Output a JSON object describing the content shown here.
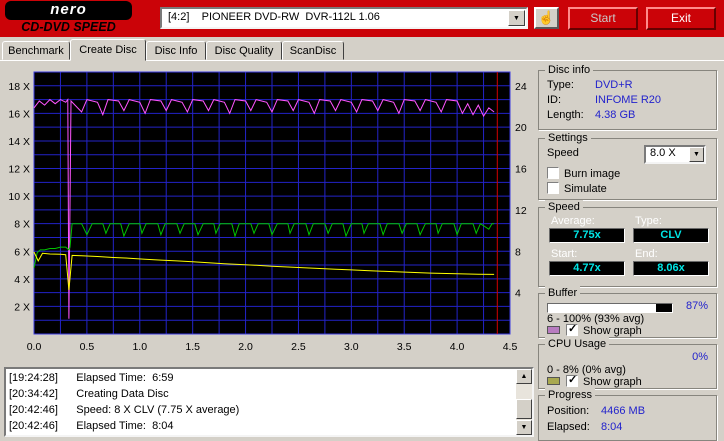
{
  "icons": {
    "chevron_down": "▼",
    "arrow_up": "▲",
    "arrow_down": "▼",
    "hand": "☝",
    "check": "✓"
  },
  "header": {
    "logo_primary": "nero",
    "logo_secondary": "CD-DVD SPEED",
    "drive_select": "[4:2]    PIONEER DVD-RW  DVR-112L 1.06",
    "start_label": "Start",
    "exit_label": "Exit"
  },
  "tabs": [
    {
      "label": "Benchmark"
    },
    {
      "label": "Create Disc"
    },
    {
      "label": "Disc Info"
    },
    {
      "label": "Disc Quality"
    },
    {
      "label": "ScanDisc"
    }
  ],
  "chart_data": {
    "type": "line",
    "title": "Create Disc write test",
    "x_axis": {
      "min": 0,
      "max": 4.5,
      "grid_step": 0.25,
      "unit": "GB",
      "ticks": [
        {
          "v": 0,
          "label": "0.0"
        },
        {
          "v": 0.5,
          "label": "0.5"
        },
        {
          "v": 1,
          "label": "1.0"
        },
        {
          "v": 1.5,
          "label": "1.5"
        },
        {
          "v": 2,
          "label": "2.0"
        },
        {
          "v": 2.5,
          "label": "2.5"
        },
        {
          "v": 3,
          "label": "3.0"
        },
        {
          "v": 3.5,
          "label": "3.5"
        },
        {
          "v": 4,
          "label": "4.0"
        },
        {
          "v": 4.5,
          "label": "4.5"
        }
      ]
    },
    "y_axis_left": {
      "min": 0,
      "max": 19,
      "grid_step": 1,
      "unit": "x speed",
      "ticks": [
        {
          "v": 2,
          "label": "2 X"
        },
        {
          "v": 4,
          "label": "4 X"
        },
        {
          "v": 6,
          "label": "6 X"
        },
        {
          "v": 8,
          "label": "8 X"
        },
        {
          "v": 10,
          "label": "10 X"
        },
        {
          "v": 12,
          "label": "12 X"
        },
        {
          "v": 14,
          "label": "14 X"
        },
        {
          "v": 16,
          "label": "16 X"
        },
        {
          "v": 18,
          "label": "18 X"
        }
      ]
    },
    "y_axis_right": {
      "scale_to_left": 0.75,
      "ticks": [
        {
          "v": 4,
          "label": "4"
        },
        {
          "v": 8,
          "label": "8"
        },
        {
          "v": 12,
          "label": "12"
        },
        {
          "v": 16,
          "label": "16"
        },
        {
          "v": 20,
          "label": "20"
        },
        {
          "v": 24,
          "label": "24"
        }
      ]
    },
    "colors": {
      "background": "#000000",
      "grid": "#2323c8",
      "border": "#3a3ae0"
    },
    "series": [
      {
        "name": "buffer-level",
        "color": "#ff55ff",
        "points": [
          [
            0,
            16.4
          ],
          [
            0.05,
            16.9
          ],
          [
            0.1,
            16.6
          ],
          [
            0.15,
            17
          ],
          [
            0.2,
            16.7
          ],
          [
            0.25,
            17
          ],
          [
            0.3,
            16.8
          ],
          [
            0.32,
            17
          ],
          [
            0.33,
            1.1
          ],
          [
            0.35,
            16.9
          ],
          [
            0.45,
            16.1
          ],
          [
            0.5,
            17
          ],
          [
            0.6,
            16.8
          ],
          [
            0.65,
            15.9
          ],
          [
            0.7,
            17
          ],
          [
            0.8,
            16.9
          ],
          [
            0.85,
            16.2
          ],
          [
            0.9,
            17
          ],
          [
            1,
            16.8
          ],
          [
            1.05,
            16
          ],
          [
            1.1,
            17
          ],
          [
            1.2,
            16.9
          ],
          [
            1.25,
            16.2
          ],
          [
            1.3,
            17
          ],
          [
            1.4,
            16.8
          ],
          [
            1.45,
            16.1
          ],
          [
            1.5,
            17
          ],
          [
            1.6,
            16.9
          ],
          [
            1.65,
            16.2
          ],
          [
            1.7,
            17
          ],
          [
            1.8,
            16.8
          ],
          [
            1.85,
            16
          ],
          [
            1.9,
            17
          ],
          [
            2,
            16.9
          ],
          [
            2.05,
            16.2
          ],
          [
            2.1,
            17
          ],
          [
            2.2,
            16.8
          ],
          [
            2.25,
            16.1
          ],
          [
            2.3,
            17
          ],
          [
            2.4,
            16.9
          ],
          [
            2.45,
            16.2
          ],
          [
            2.5,
            17
          ],
          [
            2.6,
            16.8
          ],
          [
            2.65,
            16
          ],
          [
            2.7,
            17
          ],
          [
            2.8,
            16.9
          ],
          [
            2.85,
            16.2
          ],
          [
            2.9,
            17
          ],
          [
            3,
            16.8
          ],
          [
            3.05,
            16.1
          ],
          [
            3.1,
            17
          ],
          [
            3.2,
            16.9
          ],
          [
            3.25,
            16.2
          ],
          [
            3.3,
            17
          ],
          [
            3.4,
            16.8
          ],
          [
            3.45,
            16
          ],
          [
            3.5,
            17
          ],
          [
            3.6,
            16.9
          ],
          [
            3.65,
            16.2
          ],
          [
            3.7,
            17
          ],
          [
            3.8,
            16.8
          ],
          [
            3.85,
            16.1
          ],
          [
            3.9,
            17
          ],
          [
            4,
            16.9
          ],
          [
            4.05,
            16
          ],
          [
            4.1,
            16.7
          ],
          [
            4.15,
            15.9
          ],
          [
            4.2,
            16.6
          ],
          [
            4.25,
            15.8
          ],
          [
            4.3,
            16.4
          ],
          [
            4.35,
            16.1
          ]
        ]
      },
      {
        "name": "write-speed",
        "color": "#00c400",
        "points": [
          [
            0,
            4.8
          ],
          [
            0.03,
            5.9
          ],
          [
            0.06,
            6.1
          ],
          [
            0.1,
            6.1
          ],
          [
            0.15,
            6.2
          ],
          [
            0.2,
            6.2
          ],
          [
            0.25,
            6.3
          ],
          [
            0.3,
            6.3
          ],
          [
            0.33,
            6.1
          ],
          [
            0.34,
            6.3
          ],
          [
            0.36,
            8
          ],
          [
            0.45,
            8
          ],
          [
            0.5,
            7.2
          ],
          [
            0.55,
            8
          ],
          [
            0.65,
            8
          ],
          [
            0.68,
            7.3
          ],
          [
            0.72,
            8
          ],
          [
            0.82,
            8
          ],
          [
            0.85,
            7.1
          ],
          [
            0.9,
            8
          ],
          [
            1,
            8
          ],
          [
            1.02,
            7.3
          ],
          [
            1.06,
            8
          ],
          [
            1.17,
            8
          ],
          [
            1.2,
            7.2
          ],
          [
            1.24,
            8
          ],
          [
            1.35,
            8
          ],
          [
            1.38,
            7.3
          ],
          [
            1.42,
            8
          ],
          [
            1.52,
            8
          ],
          [
            1.55,
            7.2
          ],
          [
            1.6,
            8
          ],
          [
            1.7,
            8
          ],
          [
            1.72,
            7.3
          ],
          [
            1.76,
            8
          ],
          [
            1.87,
            8
          ],
          [
            1.9,
            7.1
          ],
          [
            1.94,
            8
          ],
          [
            2.05,
            8
          ],
          [
            2.08,
            7.3
          ],
          [
            2.12,
            8
          ],
          [
            2.22,
            8
          ],
          [
            2.25,
            7.2
          ],
          [
            2.3,
            8
          ],
          [
            2.4,
            8
          ],
          [
            2.42,
            7.3
          ],
          [
            2.46,
            8
          ],
          [
            2.57,
            8
          ],
          [
            2.6,
            7.2
          ],
          [
            2.64,
            8
          ],
          [
            2.75,
            8
          ],
          [
            2.78,
            7.3
          ],
          [
            2.82,
            8
          ],
          [
            2.92,
            8
          ],
          [
            2.95,
            7.1
          ],
          [
            3,
            8
          ],
          [
            3.1,
            8
          ],
          [
            3.12,
            7.3
          ],
          [
            3.16,
            8
          ],
          [
            3.27,
            8
          ],
          [
            3.3,
            7.2
          ],
          [
            3.34,
            8
          ],
          [
            3.45,
            8
          ],
          [
            3.48,
            7.3
          ],
          [
            3.52,
            8
          ],
          [
            3.62,
            8
          ],
          [
            3.65,
            7.2
          ],
          [
            3.7,
            8
          ],
          [
            3.8,
            8
          ],
          [
            3.82,
            7.3
          ],
          [
            3.86,
            8
          ],
          [
            3.97,
            8
          ],
          [
            4,
            7.2
          ],
          [
            4.04,
            8
          ],
          [
            4.15,
            8
          ],
          [
            4.18,
            7.3
          ],
          [
            4.22,
            8
          ],
          [
            4.3,
            7.6
          ],
          [
            4.33,
            8
          ],
          [
            4.35,
            8
          ]
        ]
      },
      {
        "name": "rotation-speed",
        "color": "#ffff00",
        "points": [
          [
            0,
            5.95
          ],
          [
            0.04,
            5.3
          ],
          [
            0.08,
            5.85
          ],
          [
            0.15,
            5.8
          ],
          [
            0.25,
            5.78
          ],
          [
            0.3,
            5.75
          ],
          [
            0.33,
            3.2
          ],
          [
            0.36,
            5.7
          ],
          [
            0.45,
            5.68
          ],
          [
            0.6,
            5.62
          ],
          [
            0.75,
            5.55
          ],
          [
            0.9,
            5.5
          ],
          [
            1.05,
            5.42
          ],
          [
            1.2,
            5.36
          ],
          [
            1.35,
            5.3
          ],
          [
            1.5,
            5.24
          ],
          [
            1.65,
            5.17
          ],
          [
            1.8,
            5.1
          ],
          [
            1.95,
            5.04
          ],
          [
            2.1,
            4.98
          ],
          [
            2.25,
            4.92
          ],
          [
            2.4,
            4.86
          ],
          [
            2.55,
            4.8
          ],
          [
            2.7,
            4.75
          ],
          [
            2.85,
            4.7
          ],
          [
            3,
            4.65
          ],
          [
            3.15,
            4.6
          ],
          [
            3.3,
            4.55
          ],
          [
            3.45,
            4.5
          ],
          [
            3.6,
            4.46
          ],
          [
            3.75,
            4.42
          ],
          [
            3.9,
            4.39
          ],
          [
            4.05,
            4.36
          ],
          [
            4.2,
            4.34
          ],
          [
            4.35,
            4.32
          ]
        ]
      },
      {
        "name": "end-of-disc-marker",
        "color": "#d40000",
        "points": [
          [
            4.38,
            0
          ],
          [
            4.38,
            19
          ]
        ]
      }
    ]
  },
  "log": {
    "lines": [
      "[19:24:28]      Elapsed Time:  6:59",
      "[20:34:42]      Creating Data Disc",
      "[20:42:46]      Speed: 8 X CLV (7.75 X average)",
      "[20:42:46]      Elapsed Time:  8:04"
    ]
  },
  "panels": {
    "disc_info": {
      "title": "Disc info",
      "type_label": "Type:",
      "type": "DVD+R",
      "id_label": "ID:",
      "id": "INFOME R20",
      "length_label": "Length:",
      "length": "4.38 GB"
    },
    "settings": {
      "title": "Settings",
      "speed_label": "Speed",
      "speed_value": "8.0 X",
      "burn_image_label": "Burn image",
      "burn_image_check": "",
      "simulate_label": "Simulate",
      "simulate_check": ""
    },
    "speed": {
      "title": "Speed",
      "average_label": "Average:",
      "average": "7.75x",
      "type_label": "Type:",
      "type": "CLV",
      "start_label": "Start:",
      "start": "4.77x",
      "end_label": "End:",
      "end": "8.06x"
    },
    "buffer": {
      "title": "Buffer",
      "percent": "87%",
      "percent_value": 87,
      "range": "6 - 100% (93% avg)",
      "swatch_color": "#b87cc0",
      "show_graph_label": "Show graph",
      "show_graph_check": "✓"
    },
    "cpu": {
      "title": "CPU Usage",
      "percent": "0%",
      "percent_value": 0,
      "range": "0 - 8% (0% avg)",
      "swatch_color": "#a8a850",
      "show_graph_label": "Show graph",
      "show_graph_check": "✓"
    },
    "progress": {
      "title": "Progress",
      "position_label": "Position:",
      "position": "4466 MB",
      "elapsed_label": "Elapsed:",
      "elapsed": "8:04"
    }
  }
}
